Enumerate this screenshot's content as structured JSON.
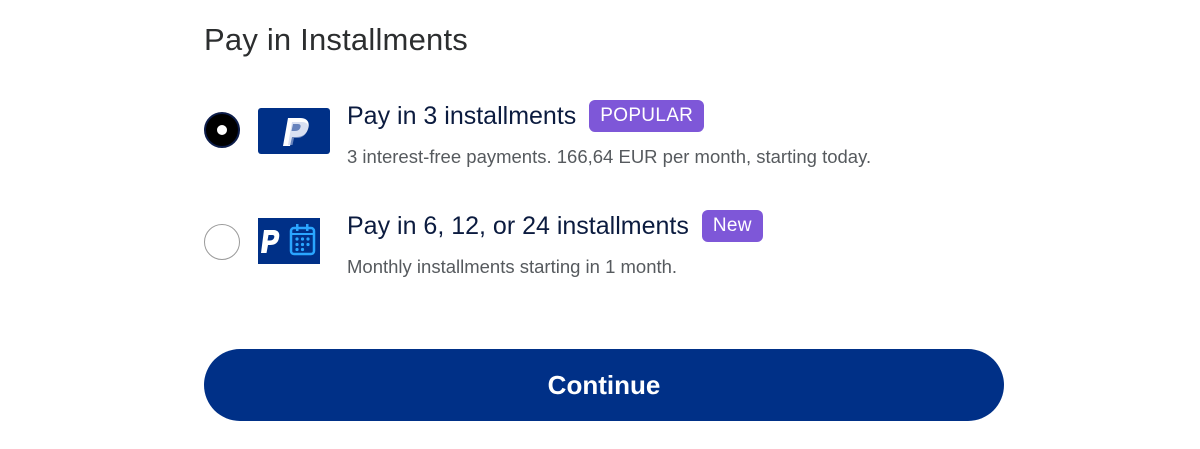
{
  "section": {
    "title": "Pay in Installments"
  },
  "options": [
    {
      "title": "Pay in 3 installments",
      "badge": "POPULAR",
      "description": "3 interest-free payments. 166,64 EUR per month, starting today.",
      "selected": true,
      "icon": "paypal-logo-icon"
    },
    {
      "title": "Pay in 6, 12, or 24 installments",
      "badge": "New",
      "description": "Monthly installments starting in 1 month.",
      "selected": false,
      "icon": "paypal-calendar-icon"
    }
  ],
  "actions": {
    "continue_label": "Continue"
  },
  "colors": {
    "primary": "#003087",
    "badge": "#7e57d8",
    "title_text": "#0b1b3f",
    "description_text": "#565a5e",
    "calendar_accent": "#2aa6ff"
  }
}
